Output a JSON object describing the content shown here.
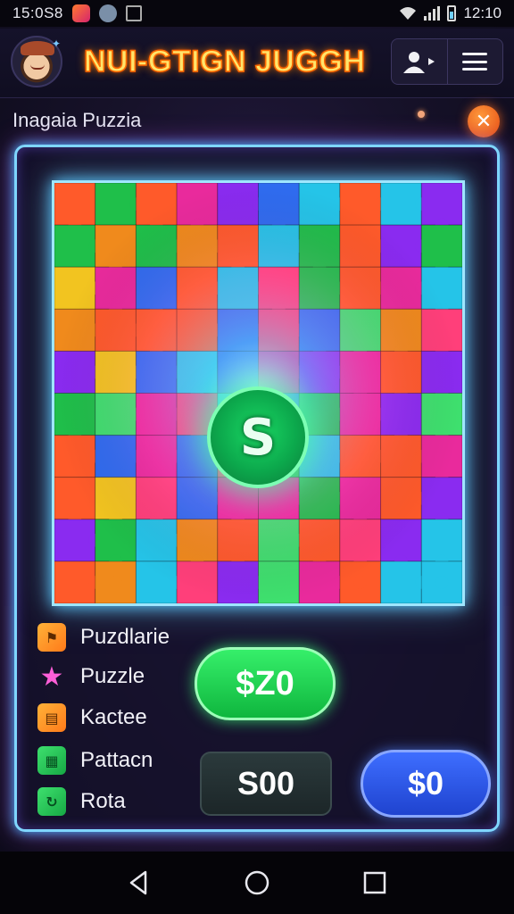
{
  "status_bar": {
    "time": "15:0S8",
    "clock": "12:10",
    "icons": [
      "app-icon",
      "weather-icon",
      "notification-icon",
      "wifi-icon",
      "signal-icon",
      "battery-icon"
    ]
  },
  "header": {
    "title": "NUI-GTIGN JUGGH",
    "profile_icon": "profile-switch-icon",
    "menu_icon": "hamburger-icon"
  },
  "subtitle": "Inagaia Puzzia",
  "board": {
    "center_symbol": "S",
    "colors": [
      "#e92a9c",
      "#1fbf4a",
      "#2f6cf0",
      "#f2c420",
      "#ff5a2a",
      "#8a2bf0",
      "#25c4e8",
      "#ff3f7a",
      "#3ee06e",
      "#f08a1c"
    ]
  },
  "menu": [
    {
      "label": "Puzdlarie",
      "icon": "flag-icon"
    },
    {
      "label": "Puzzle",
      "icon": "star-icon"
    },
    {
      "label": "Kactee",
      "icon": "box-icon"
    },
    {
      "label": "Pattacn",
      "icon": "pattern-icon"
    },
    {
      "label": "Rota",
      "icon": "rotate-icon"
    }
  ],
  "buttons": {
    "primary": "$Z0",
    "secondary": "S00",
    "tertiary": "$0"
  },
  "accent_colors": {
    "frame_glow": "#7fd6ff",
    "title_fill": "#ffe56b",
    "title_stroke": "#ff6a00",
    "primary_button": "#1fd457",
    "tertiary_button": "#2d57e6"
  }
}
